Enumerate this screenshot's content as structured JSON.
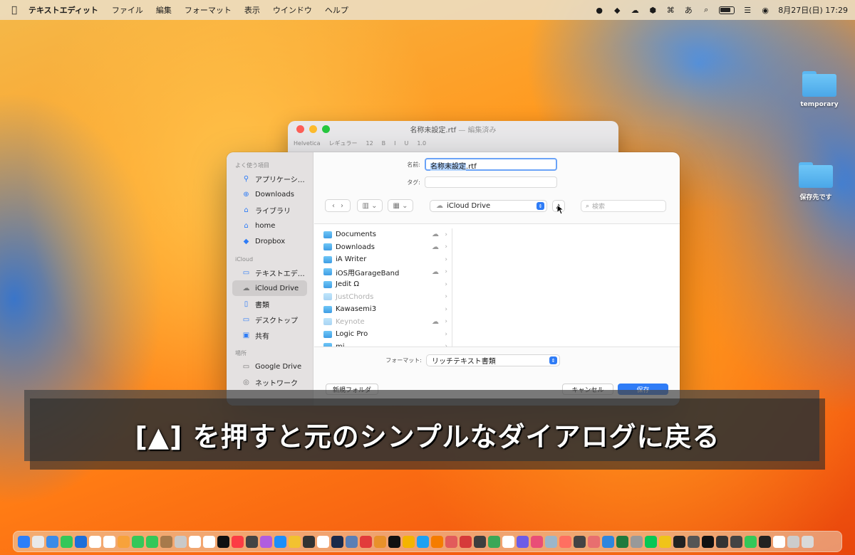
{
  "menubar": {
    "app_name": "テキストエディット",
    "items": [
      "ファイル",
      "編集",
      "フォーマット",
      "表示",
      "ウインドウ",
      "ヘルプ"
    ],
    "ime": "あ",
    "datetime": "8月27日(日)  17:29"
  },
  "desktop": {
    "folders": [
      {
        "label": "temporary"
      },
      {
        "label": "保存先です"
      }
    ]
  },
  "textedit_window": {
    "title": "名称未設定.rtf",
    "subtitle": "— 編集済み",
    "toolbar": [
      "Helvetica",
      "レギュラー",
      "12",
      "B",
      "I",
      "U",
      "1.0"
    ]
  },
  "dialog": {
    "sidebar": {
      "favorites_header": "よく使う項目",
      "favorites": [
        {
          "label": "アプリケーシ…",
          "icon": "applications-icon"
        },
        {
          "label": "Downloads",
          "icon": "downloads-icon"
        },
        {
          "label": "ライブラリ",
          "icon": "library-icon"
        },
        {
          "label": "home",
          "icon": "home-icon"
        },
        {
          "label": "Dropbox",
          "icon": "dropbox-icon"
        }
      ],
      "icloud_header": "iCloud",
      "icloud": [
        {
          "label": "テキストエデ…",
          "icon": "folder-icon"
        },
        {
          "label": "iCloud Drive",
          "icon": "cloud-icon"
        },
        {
          "label": "書類",
          "icon": "document-icon"
        },
        {
          "label": "デスクトップ",
          "icon": "desktop-icon"
        },
        {
          "label": "共有",
          "icon": "shared-icon"
        }
      ],
      "locations_header": "場所",
      "locations": [
        {
          "label": "Google Drive",
          "icon": "drive-icon"
        },
        {
          "label": "ネットワーク",
          "icon": "network-icon"
        }
      ]
    },
    "name_label": "名前:",
    "name_value_selected": "名称未設定",
    "name_value_ext": ".rtf",
    "tag_label": "タグ:",
    "location": "iCloud Drive",
    "search_placeholder": "検索",
    "files": [
      {
        "name": "Documents",
        "cloud": true,
        "dim": false
      },
      {
        "name": "Downloads",
        "cloud": true,
        "dim": false
      },
      {
        "name": "iA Writer",
        "cloud": false,
        "dim": false
      },
      {
        "name": "iOS用GarageBand",
        "cloud": true,
        "dim": false
      },
      {
        "name": "Jedit Ω",
        "cloud": false,
        "dim": false
      },
      {
        "name": "JustChords",
        "cloud": false,
        "dim": true
      },
      {
        "name": "Kawasemi3",
        "cloud": false,
        "dim": false
      },
      {
        "name": "Keynote",
        "cloud": true,
        "dim": true
      },
      {
        "name": "Logic Pro",
        "cloud": false,
        "dim": false
      },
      {
        "name": "mi",
        "cloud": false,
        "dim": false
      }
    ],
    "format_label": "フォーマット:",
    "format_value": "リッチテキスト書類",
    "new_folder_button": "新規フォルダ",
    "cancel_button": "キャンセル",
    "save_button": "保存"
  },
  "caption": "[▲] を押すと元のシンプルなダイアログに戻る",
  "colors": {
    "accent": "#2f7cf6",
    "folder": "#4aa7e8"
  }
}
